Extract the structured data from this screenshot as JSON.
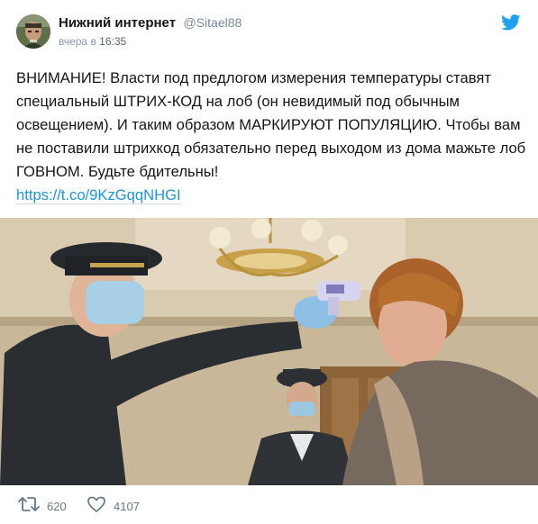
{
  "tweet": {
    "author": {
      "display_name": "Нижний интернет",
      "handle": "@Sitael88"
    },
    "timestamp_prefix": "вчера в",
    "timestamp_time": "16:35",
    "text": "ВНИМАНИЕ! Власти под предлогом измерения температуры ставят специальный ШТРИХ-КОД на лоб (он невидимый под обычным освещением). И таким образом МАРКИРУЮТ ПОПУЛЯЦИЮ. Чтобы вам не поставили штрихкод обязательно перед выходом из дома мажьте лоб ГОВНОМ. Будьте бдительны!",
    "link": "https://t.co/9KzGqqNHGI",
    "retweet_count": "620",
    "like_count": "4107"
  },
  "icons": {
    "brand": "twitter-bird-icon",
    "retweet": "retweet-icon",
    "like": "heart-icon"
  },
  "colors": {
    "brand": "#1da1f2",
    "link": "#1b95e0",
    "muted": "#657786"
  }
}
